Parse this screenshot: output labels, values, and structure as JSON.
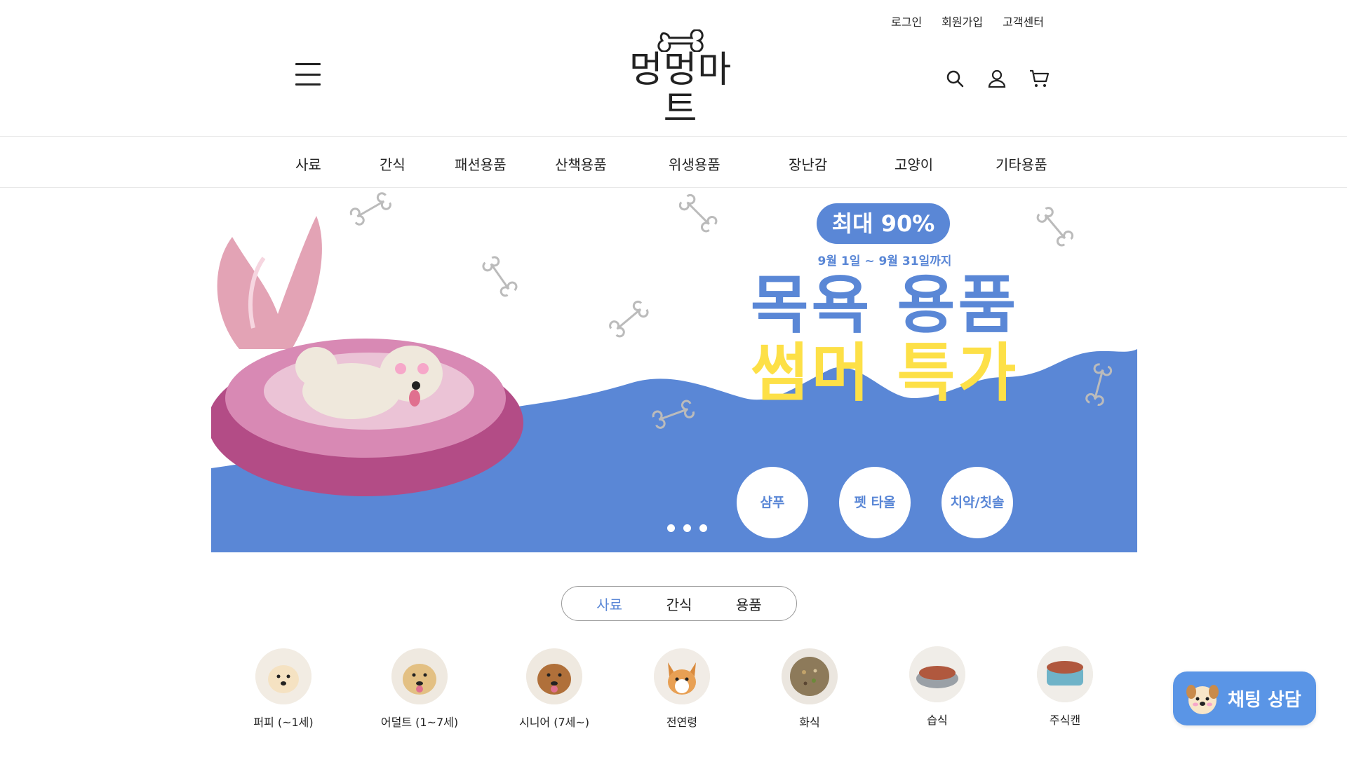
{
  "util_links": [
    "로그인",
    "회원가입",
    "고객센터"
  ],
  "logo": {
    "text": "멍멍마트"
  },
  "nav": [
    "사료",
    "간식",
    "패션용품",
    "산책용품",
    "위생용품",
    "장난감",
    "고양이",
    "기타용품"
  ],
  "banner": {
    "badge": "최대 90%",
    "dates": "9월 1일 ~ 9월 31일까지",
    "headline1": "목욕 용품",
    "headline2": "썸머 특가",
    "circles": [
      "샴푸",
      "펫 타올",
      "치약/칫솔"
    ],
    "slide_count": 3
  },
  "tabs": {
    "items": [
      "사료",
      "간식",
      "용품"
    ],
    "active": 0
  },
  "subcategories": [
    "퍼피 (~1세)",
    "어덜트 (1~7세)",
    "시니어 (7세~)",
    "전연령",
    "화식",
    "습식",
    "주식캔"
  ],
  "chat": {
    "label": "채팅 상담"
  },
  "colors": {
    "accent": "#5a87d6",
    "yellow": "#fde047",
    "chat": "#5a95e6"
  }
}
